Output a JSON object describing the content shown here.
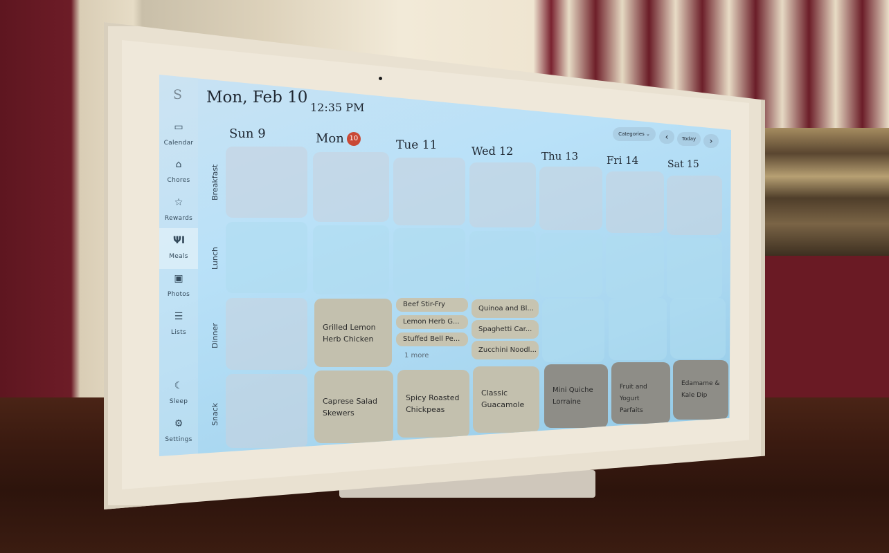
{
  "app": {
    "logo": "S"
  },
  "header": {
    "date": "Mon, Feb 10",
    "time": "12:35 PM"
  },
  "sidebar": {
    "items": [
      {
        "label": "Calendar",
        "icon": "calendar-icon",
        "glyph": "▭"
      },
      {
        "label": "Chores",
        "icon": "broom-icon",
        "glyph": "⌂"
      },
      {
        "label": "Rewards",
        "icon": "star-icon",
        "glyph": "☆"
      },
      {
        "label": "Meals",
        "icon": "utensils-icon",
        "glyph": "ΨI",
        "active": true
      },
      {
        "label": "Photos",
        "icon": "photo-icon",
        "glyph": "▣"
      },
      {
        "label": "Lists",
        "icon": "list-icon",
        "glyph": "☰"
      },
      {
        "label": "Sleep",
        "icon": "moon-icon",
        "glyph": "☾"
      },
      {
        "label": "Settings",
        "icon": "gear-icon",
        "glyph": "⚙"
      }
    ]
  },
  "toolbar": {
    "categories": "Categories",
    "categories_chevron": "⌄",
    "prev": "‹",
    "today": "Today",
    "next": "›"
  },
  "days": [
    {
      "label": "Sun 9"
    },
    {
      "label": "Mon",
      "badge": "10",
      "today": true
    },
    {
      "label": "Tue 11"
    },
    {
      "label": "Wed 12"
    },
    {
      "label": "Thu 13"
    },
    {
      "label": "Fri 14"
    },
    {
      "label": "Sat 15"
    }
  ],
  "meal_types": [
    "Breakfast",
    "Lunch",
    "Dinner",
    "Snack"
  ],
  "meals": {
    "dinner": {
      "mon": "Grilled Lemon Herb Chicken",
      "tue": [
        "Beef Stir-Fry",
        "Lemon Herb G...",
        "Stuffed Bell Pe..."
      ],
      "tue_more": "1 more",
      "wed": [
        "Quinoa and Bl...",
        "Spaghetti Car...",
        "Zucchini Noodl..."
      ]
    },
    "snack": {
      "mon": "Caprese Salad Skewers",
      "tue": "Spicy Roasted Chickpeas",
      "wed": "Classic Guacamole",
      "thu": "Mini Quiche Lorraine",
      "fri": "Fruit and Yogurt Parfaits",
      "sat": "Edamame & Kale Dip"
    }
  },
  "colors": {
    "today_badge": "#c94936",
    "meal_card": "#c3c0ae",
    "screen_bg": "#b9e1f8"
  }
}
